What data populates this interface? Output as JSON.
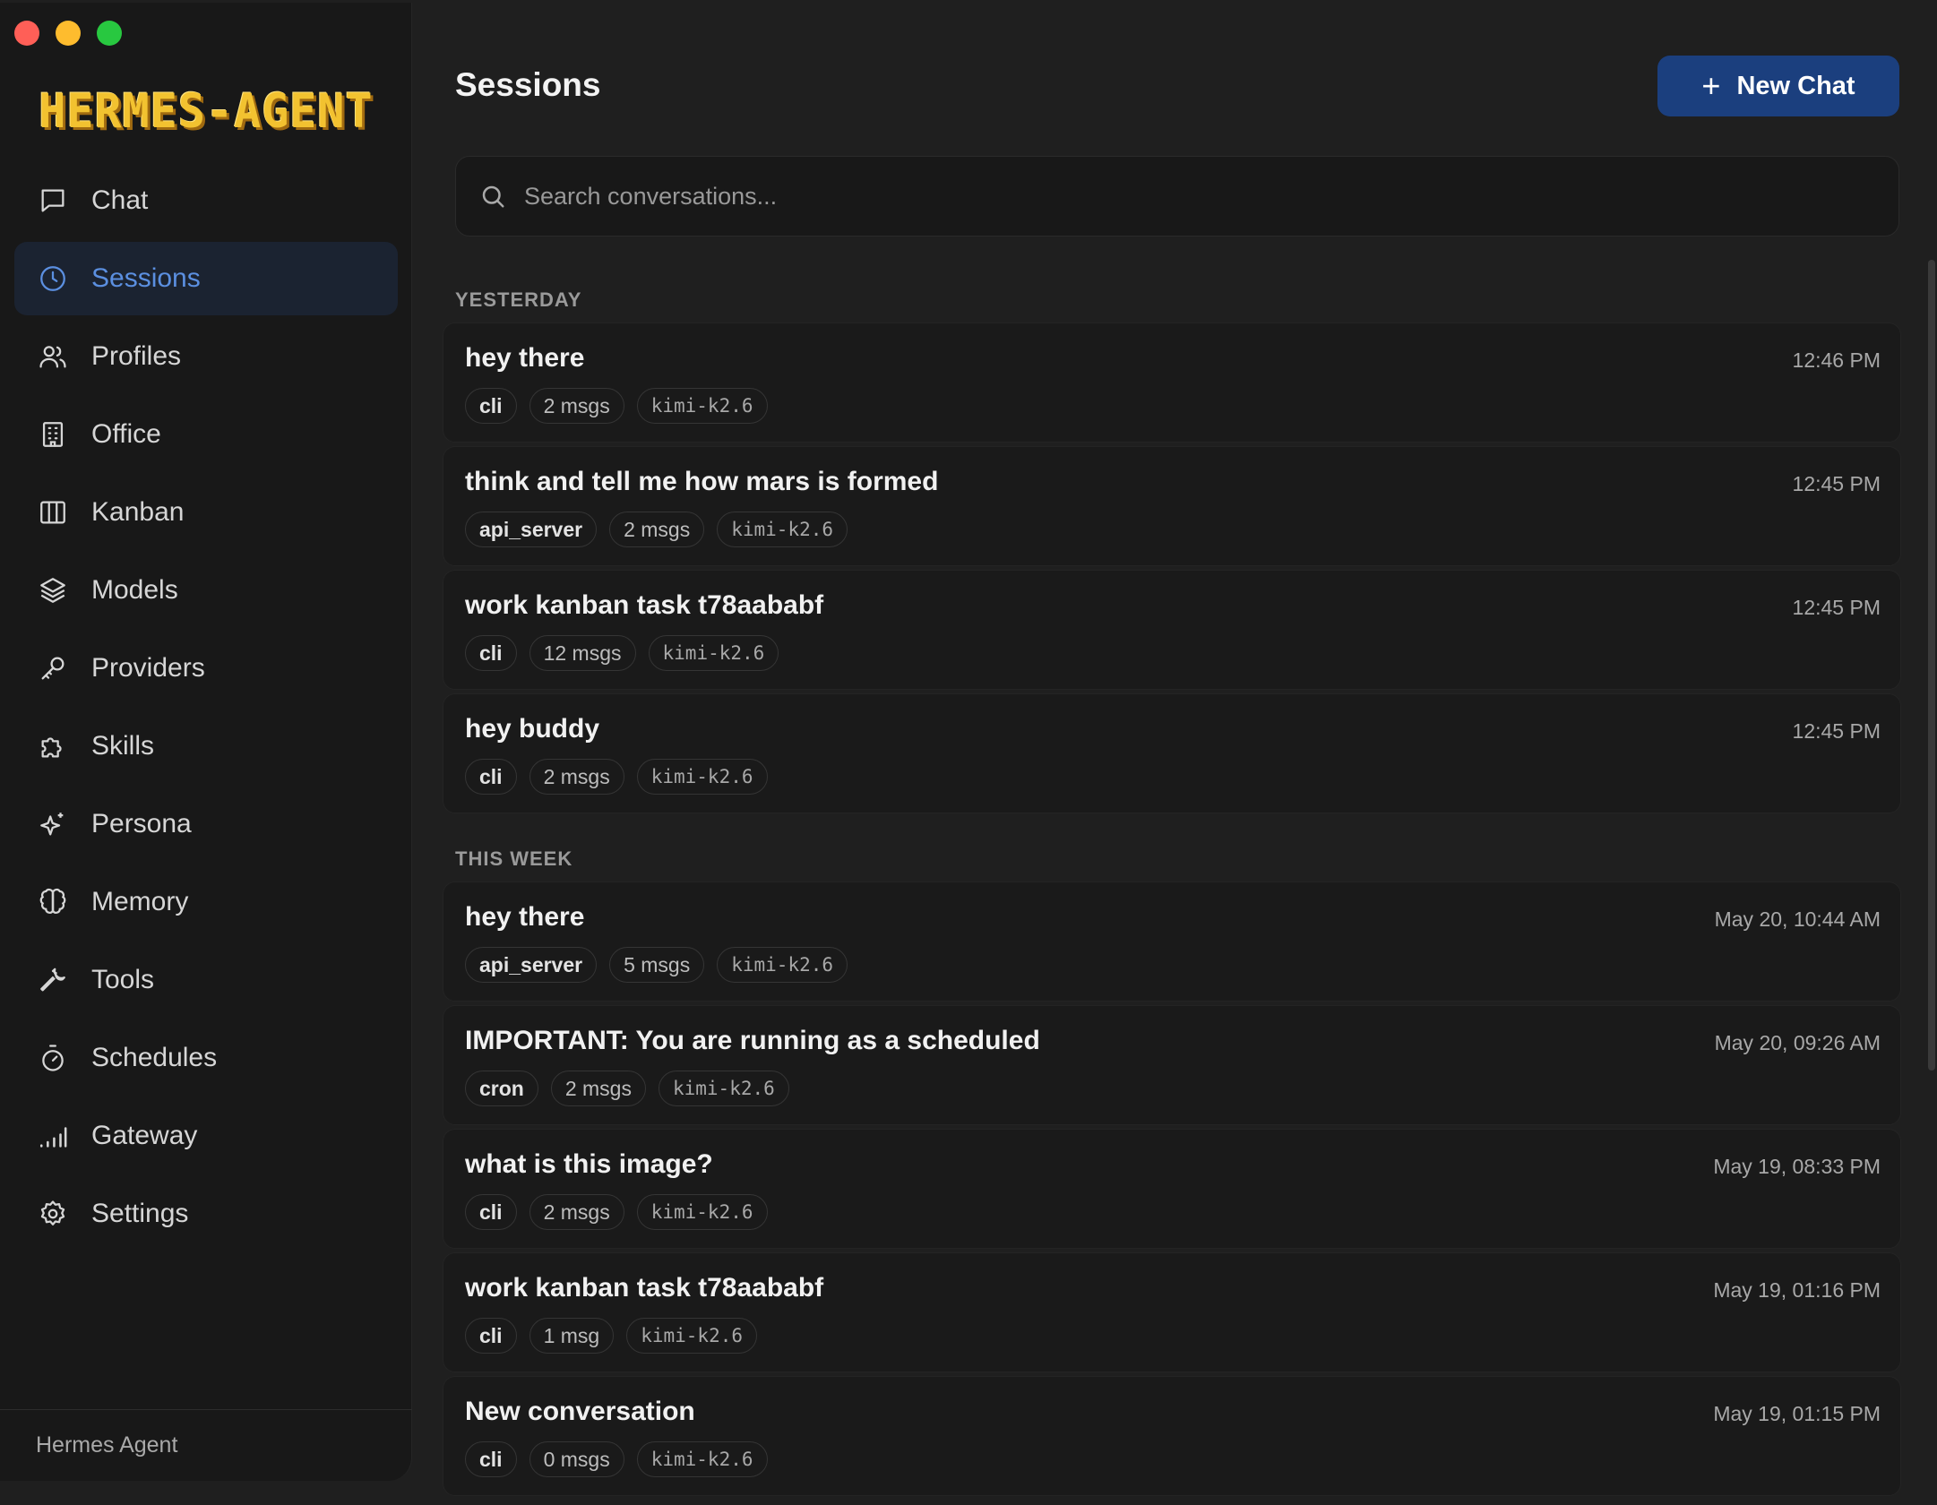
{
  "app": {
    "logo_text": "HERMES-AGENT",
    "footer_label": "Hermes Agent"
  },
  "sidebar": {
    "items": [
      {
        "label": "Chat",
        "icon": "chat-bubble-icon"
      },
      {
        "label": "Sessions",
        "icon": "clock-icon",
        "active": true
      },
      {
        "label": "Profiles",
        "icon": "users-icon"
      },
      {
        "label": "Office",
        "icon": "building-icon"
      },
      {
        "label": "Kanban",
        "icon": "columns-icon"
      },
      {
        "label": "Models",
        "icon": "layers-icon"
      },
      {
        "label": "Providers",
        "icon": "key-icon"
      },
      {
        "label": "Skills",
        "icon": "puzzle-icon"
      },
      {
        "label": "Persona",
        "icon": "sparkles-icon"
      },
      {
        "label": "Memory",
        "icon": "brain-icon"
      },
      {
        "label": "Tools",
        "icon": "wrench-icon"
      },
      {
        "label": "Schedules",
        "icon": "timer-icon"
      },
      {
        "label": "Gateway",
        "icon": "signal-icon"
      },
      {
        "label": "Settings",
        "icon": "gear-icon"
      }
    ]
  },
  "header": {
    "title": "Sessions",
    "new_chat_label": "New Chat"
  },
  "search": {
    "placeholder": "Search conversations..."
  },
  "groups": [
    {
      "label": "YESTERDAY",
      "sessions": [
        {
          "title": "hey there",
          "time": "12:46 PM",
          "source": "cli",
          "msgs": "2 msgs",
          "model": "kimi-k2.6"
        },
        {
          "title": "think and tell me how mars is formed",
          "time": "12:45 PM",
          "source": "api_server",
          "msgs": "2 msgs",
          "model": "kimi-k2.6"
        },
        {
          "title": "work kanban task t78aababf",
          "time": "12:45 PM",
          "source": "cli",
          "msgs": "12 msgs",
          "model": "kimi-k2.6"
        },
        {
          "title": "hey buddy",
          "time": "12:45 PM",
          "source": "cli",
          "msgs": "2 msgs",
          "model": "kimi-k2.6"
        }
      ]
    },
    {
      "label": "THIS WEEK",
      "sessions": [
        {
          "title": "hey there",
          "time": "May 20, 10:44 AM",
          "source": "api_server",
          "msgs": "5 msgs",
          "model": "kimi-k2.6"
        },
        {
          "title": "IMPORTANT: You are running as a scheduled",
          "time": "May 20, 09:26 AM",
          "source": "cron",
          "msgs": "2 msgs",
          "model": "kimi-k2.6"
        },
        {
          "title": "what is this image?",
          "time": "May 19, 08:33 PM",
          "source": "cli",
          "msgs": "2 msgs",
          "model": "kimi-k2.6"
        },
        {
          "title": "work kanban task t78aababf",
          "time": "May 19, 01:16 PM",
          "source": "cli",
          "msgs": "1 msg",
          "model": "kimi-k2.6"
        },
        {
          "title": "New conversation",
          "time": "May 19, 01:15 PM",
          "source": "cli",
          "msgs": "0 msgs",
          "model": "kimi-k2.6"
        }
      ]
    }
  ],
  "colors": {
    "accent": "#5b8fe0",
    "primary_button": "#1b3f7e",
    "active_nav_bg": "#1b2331",
    "logo": "#f2c230"
  }
}
